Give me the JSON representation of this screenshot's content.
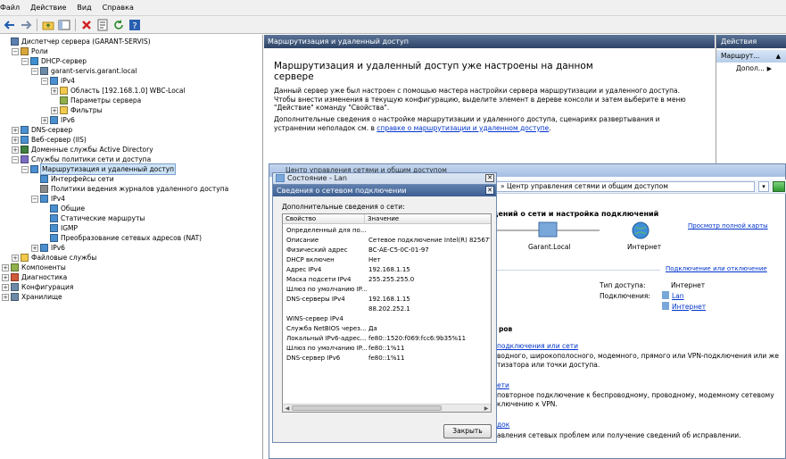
{
  "menu": [
    "Файл",
    "Действие",
    "Вид",
    "Справка"
  ],
  "toolbar_icons": [
    "back-arrow-icon",
    "forward-arrow-icon",
    "folder-up-icon",
    "show-hide-tree-icon",
    "delete-icon",
    "properties-icon",
    "refresh-icon",
    "help-icon"
  ],
  "tree": [
    {
      "label": "Диспетчер сервера (GARANT-SERVIS)",
      "level": 0,
      "exp": "",
      "icon": "server-manager-icon"
    },
    {
      "label": "Роли",
      "level": 1,
      "exp": "-",
      "icon": "roles-icon"
    },
    {
      "label": "DHCP-сервер",
      "level": 2,
      "exp": "-",
      "icon": "dhcp-icon"
    },
    {
      "label": "garant-servis.garant.local",
      "level": 3,
      "exp": "-",
      "icon": "server-icon"
    },
    {
      "label": "IPv4",
      "level": 4,
      "exp": "-",
      "icon": "ipv4-icon"
    },
    {
      "label": "Область [192.168.1.0] WBC-Local",
      "level": 5,
      "exp": "+",
      "icon": "folder-icon"
    },
    {
      "label": "Параметры сервера",
      "level": 5,
      "exp": "",
      "icon": "options-icon"
    },
    {
      "label": "Фильтры",
      "level": 5,
      "exp": "+",
      "icon": "filter-icon"
    },
    {
      "label": "IPv6",
      "level": 4,
      "exp": "+",
      "icon": "ipv6-icon"
    },
    {
      "label": "DNS-сервер",
      "level": 1,
      "exp": "+",
      "icon": "dns-icon"
    },
    {
      "label": "Веб-сервер (IIS)",
      "level": 1,
      "exp": "+",
      "icon": "iis-icon"
    },
    {
      "label": "Доменные службы Active Directory",
      "level": 1,
      "exp": "+",
      "icon": "ad-icon"
    },
    {
      "label": "Службы политики сети и доступа",
      "level": 1,
      "exp": "-",
      "icon": "nps-icon"
    },
    {
      "label": "Маршрутизация и удаленный доступ",
      "level": 2,
      "exp": "-",
      "icon": "routing-icon",
      "selected": true
    },
    {
      "label": "Интерфейсы сети",
      "level": 3,
      "exp": "",
      "icon": "interfaces-icon"
    },
    {
      "label": "Политики ведения журналов удаленного доступа",
      "level": 3,
      "exp": "",
      "icon": "logging-icon"
    },
    {
      "label": "IPv4",
      "level": 3,
      "exp": "-",
      "icon": "ipv4-icon"
    },
    {
      "label": "Общие",
      "level": 4,
      "exp": "",
      "icon": "general-icon"
    },
    {
      "label": "Статические маршруты",
      "level": 4,
      "exp": "",
      "icon": "routes-icon"
    },
    {
      "label": "IGMP",
      "level": 4,
      "exp": "",
      "icon": "igmp-icon"
    },
    {
      "label": "Преобразование сетевых адресов (NAT)",
      "level": 4,
      "exp": "",
      "icon": "nat-icon"
    },
    {
      "label": "IPv6",
      "level": 3,
      "exp": "+",
      "icon": "ipv6-icon"
    },
    {
      "label": "Файловые службы",
      "level": 1,
      "exp": "+",
      "icon": "file-services-icon"
    },
    {
      "label": "Компоненты",
      "level": 0,
      "exp": "+",
      "icon": "features-icon"
    },
    {
      "label": "Диагностика",
      "level": 0,
      "exp": "+",
      "icon": "diagnostics-icon"
    },
    {
      "label": "Конфигурация",
      "level": 0,
      "exp": "+",
      "icon": "configuration-icon"
    },
    {
      "label": "Хранилище",
      "level": 0,
      "exp": "+",
      "icon": "storage-icon"
    }
  ],
  "middle": {
    "header": "Маршрутизация и удаленный доступ",
    "title": "Маршрутизация и удаленный доступ уже настроены на данном сервере",
    "p1": "Данный сервер уже был настроен с помощью мастера настройки сервера маршрутизации и удаленного доступа. Чтобы внести изменения в текущую конфигурацию, выделите элемент в дереве консоли и затем выберите в меню \"Действие\" команду \"Свойства\".",
    "p2_prefix": "Дополнительные сведения о настройке маршрутизации и удаленного доступа, сценариях развертывания и устранении неполадок см. в",
    "p2_link": "справке о маршрутизации и удаленном доступе",
    "p2_suffix": "."
  },
  "actions": {
    "header": "Действия",
    "sub": "Маршрут...",
    "item": "Допол..."
  },
  "netcenter": {
    "window_title": "Центр управления сетями и общим доступом",
    "address": "» Центр управления сетями и общим доступом",
    "heading": "дений о сети и настройка подключений",
    "full_map": "Просмотр полной карты",
    "node_local": "Garant.Local",
    "node_internet": "Интернет",
    "connect_disconnect": "Подключение или отключение",
    "access_type_label": "Тип доступа:",
    "access_type_value": "Интернет",
    "connections_label": "Подключения:",
    "conn1": "Lan",
    "conn2": "Интернет",
    "section": "ров",
    "task1_link": "подключения или сети",
    "task1_desc1": "водного, широкополосного, модемного, прямого или VPN-подключения или же",
    "task1_desc2": "тизатора или точки доступа.",
    "task2_link": "ети",
    "task2_desc1": "повторное подключение к беспроводному, проводному, модемному сетевому",
    "task2_desc2": "ключению к VPN.",
    "task3_link": "док",
    "task3_desc": "авления сетевых проблем или получение сведений об исправлении."
  },
  "status_dialog": {
    "title": "Состояние - Lan"
  },
  "details_dialog": {
    "title": "Сведения о сетевом подключении",
    "label": "Дополнительные сведения о сети:",
    "col_property": "Свойство",
    "col_value": "Значение",
    "rows": [
      {
        "p": "Определенный для по...",
        "v": ""
      },
      {
        "p": "Описание",
        "v": "Сетевое подключение Intel(R) 82567V-2"
      },
      {
        "p": "Физический адрес",
        "v": "BC-AE-C5-0C-01-97"
      },
      {
        "p": "DHCP включен",
        "v": "Нет"
      },
      {
        "p": "Адрес IPv4",
        "v": "192.168.1.15"
      },
      {
        "p": "Маска подсети IPv4",
        "v": "255.255.255.0"
      },
      {
        "p": "Шлюз по умолчанию IP...",
        "v": ""
      },
      {
        "p": "DNS-серверы IPv4",
        "v": "192.168.1.15"
      },
      {
        "p": "",
        "v": "88.202.252.1"
      },
      {
        "p": "WINS-сервер IPv4",
        "v": ""
      },
      {
        "p": "Служба NetBIOS через...",
        "v": "Да"
      },
      {
        "p": "Локальный IPv6-адрес...",
        "v": "fe80::1520:f069:fcc6:9b35%11"
      },
      {
        "p": "Шлюз по умолчанию IP...",
        "v": "fe80::1%11"
      },
      {
        "p": "DNS-сервер IPv6",
        "v": "fe80::1%11"
      }
    ],
    "close": "Закрыть"
  }
}
